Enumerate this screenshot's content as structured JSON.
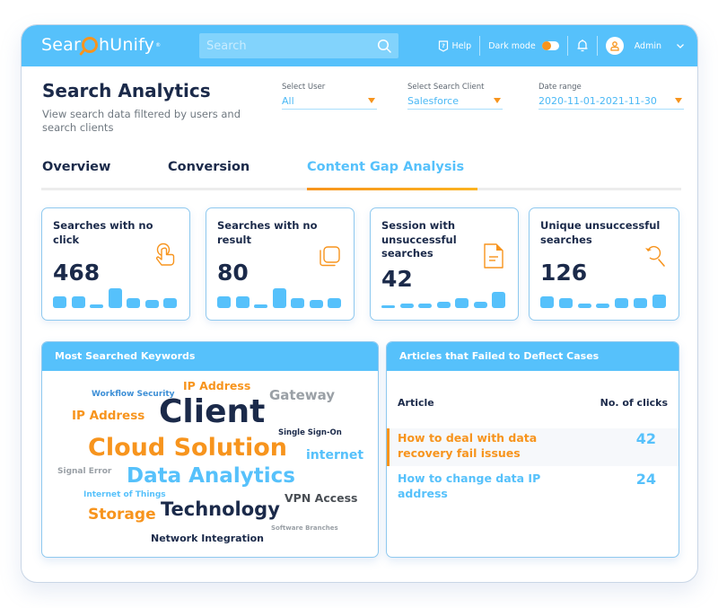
{
  "app": {
    "logo_text_left": "Sear",
    "logo_text_right": "hUnify",
    "logo_mark": "®",
    "search_placeholder": "Search",
    "help_label": "Help",
    "dark_mode_label": "Dark mode",
    "dark_mode_on": false,
    "user_name": "Admin",
    "icons": [
      "search-icon",
      "help-icon",
      "toggle-switch",
      "bell-icon",
      "user-avatar-icon",
      "chevron-down-icon"
    ]
  },
  "header": {
    "title": "Search Analytics",
    "subtitle": "View search data filtered by users and search clients"
  },
  "filters": [
    {
      "label": "Select User",
      "value": "All"
    },
    {
      "label": "Select Search Client",
      "value": "Salesforce"
    },
    {
      "label": "Date range",
      "value": "2020-11-01-2021-11-30"
    }
  ],
  "tabs": [
    {
      "label": "Overview",
      "active": false
    },
    {
      "label": "Conversion",
      "active": false
    },
    {
      "label": "Content Gap Analysis",
      "active": true
    }
  ],
  "cards": [
    {
      "title": "Searches with no click",
      "value": "468",
      "icon": "hand-pointer-icon",
      "trend": [
        3,
        3,
        1,
        5,
        2.5,
        2,
        2.5
      ]
    },
    {
      "title": "Searches with no result",
      "value": "80",
      "icon": "copy-icon",
      "trend": [
        3,
        3,
        1,
        5,
        2.5,
        2,
        2.5
      ]
    },
    {
      "title": "Session with unsuccessful searches",
      "value": "42",
      "icon": "document-icon",
      "trend": [
        0.6,
        1.2,
        1.2,
        1.5,
        2.6,
        1.5,
        4
      ]
    },
    {
      "title": "Unique unsuccessful searches",
      "value": "126",
      "icon": "search-refresh-icon",
      "trend": [
        3,
        2.6,
        1.2,
        1.2,
        2.4,
        2.6,
        3.4
      ]
    }
  ],
  "keywords_panel": {
    "title": "Most Searched Keywords",
    "colors": {
      "navy": "#1b2a4a",
      "orange": "#f7941d",
      "blue": "#56c1fb",
      "steel": "#3d8fd6",
      "gray": "#9aa0a6",
      "dark_gray": "#4a4f55"
    },
    "words": [
      {
        "text": "Workflow Security",
        "color": "steel"
      },
      {
        "text": "IP Address",
        "color": "orange"
      },
      {
        "text": "Gateway",
        "color": "gray"
      },
      {
        "text": "IP Address",
        "color": "orange"
      },
      {
        "text": "Client",
        "color": "navy"
      },
      {
        "text": "Single Sign-On",
        "color": "navy"
      },
      {
        "text": "Cloud Solution",
        "color": "orange"
      },
      {
        "text": "internet",
        "color": "blue"
      },
      {
        "text": "Signal Error",
        "color": "gray"
      },
      {
        "text": "Data Analytics",
        "color": "blue"
      },
      {
        "text": "Internet of Things",
        "color": "blue"
      },
      {
        "text": "VPN Access",
        "color": "dark_gray"
      },
      {
        "text": "Storage",
        "color": "orange"
      },
      {
        "text": "Technology",
        "color": "navy"
      },
      {
        "text": "Software Branches",
        "color": "gray"
      },
      {
        "text": "Network Integration",
        "color": "navy"
      }
    ]
  },
  "articles_panel": {
    "title": "Articles that Failed to Deflect Cases",
    "col_article": "Article",
    "col_clicks": "No. of clicks",
    "rows": [
      {
        "title": "How to deal with data recovery fail issues",
        "clicks": "42",
        "highlighted": true,
        "color": "#f7941d"
      },
      {
        "title": "How to change data IP address",
        "clicks": "24",
        "highlighted": false,
        "color": "#56c1fb"
      }
    ]
  }
}
